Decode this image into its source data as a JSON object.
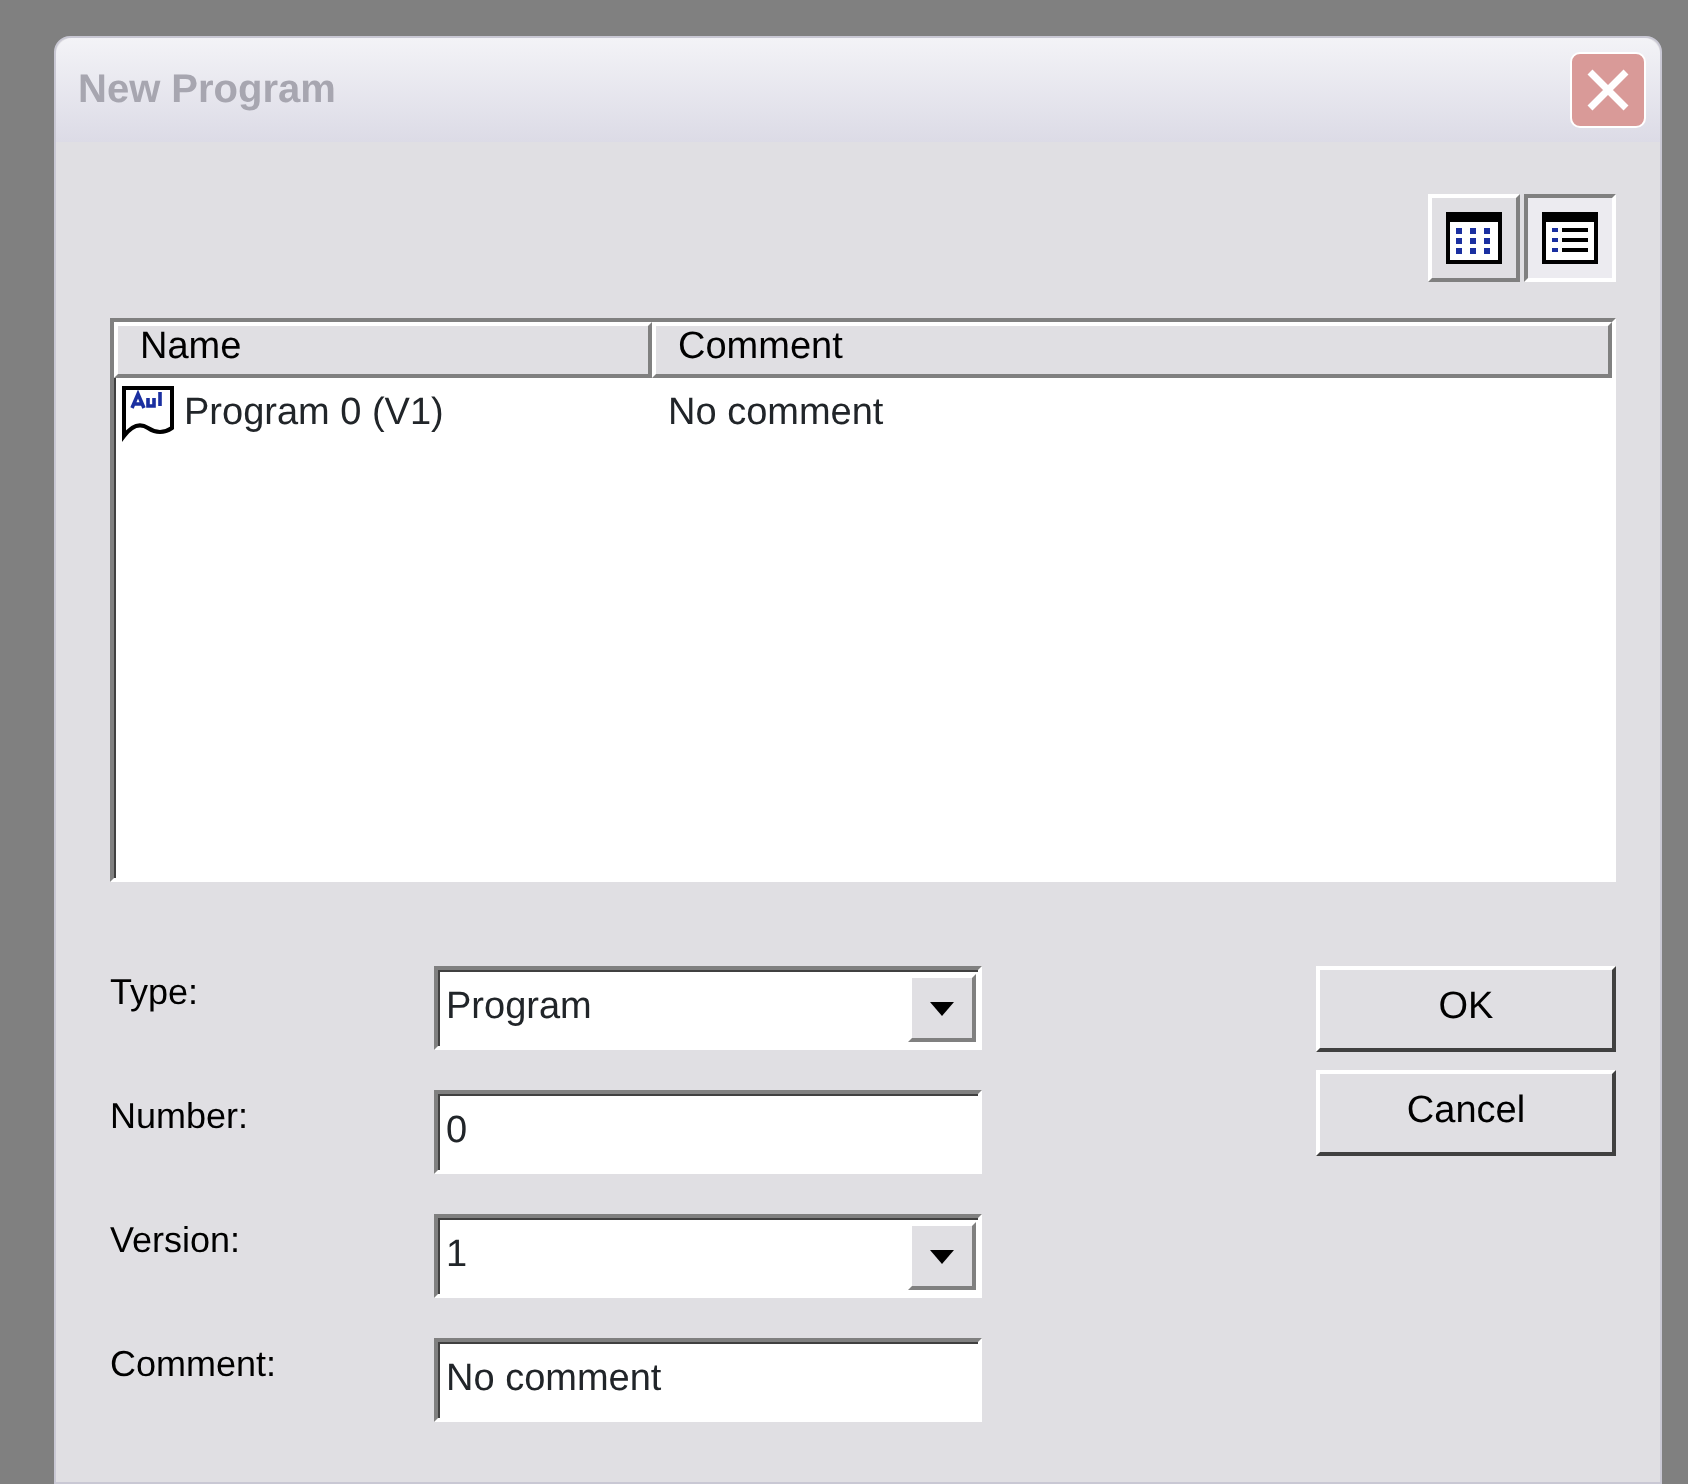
{
  "window": {
    "title": "New Program",
    "active": false
  },
  "view_buttons": [
    {
      "kind": "details",
      "selected": false
    },
    {
      "kind": "list",
      "selected": true
    }
  ],
  "list": {
    "columns": [
      "Name",
      "Comment"
    ],
    "rows": [
      {
        "name": "Program  0 (V1)",
        "comment": "No comment"
      }
    ]
  },
  "fields": [
    {
      "label": "Type:",
      "kind": "select",
      "value": "Program"
    },
    {
      "label": "Number:",
      "kind": "text",
      "value": "0"
    },
    {
      "label": "Version:",
      "kind": "select",
      "value": "1"
    },
    {
      "label": "Comment:",
      "kind": "text",
      "value": "No comment"
    }
  ],
  "buttons": [
    "OK",
    "Cancel"
  ]
}
